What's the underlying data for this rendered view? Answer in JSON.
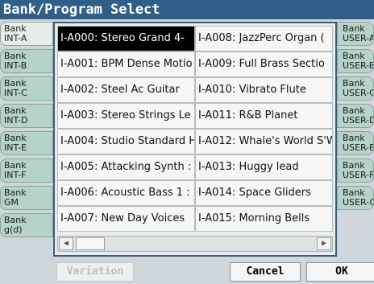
{
  "title": "Bank/Program Select",
  "left_banks": [
    {
      "label": "Bank\nINT-A",
      "selected": true
    },
    {
      "label": "Bank\nINT-B",
      "selected": false
    },
    {
      "label": "Bank\nINT-C",
      "selected": false
    },
    {
      "label": "Bank\nINT-D",
      "selected": false
    },
    {
      "label": "Bank\nINT-E",
      "selected": false
    },
    {
      "label": "Bank\nINT-F",
      "selected": false
    },
    {
      "label": "Bank\nGM",
      "selected": false
    },
    {
      "label": "Bank\ng(d)",
      "selected": false
    }
  ],
  "right_banks": [
    {
      "label": "Bank\nUSER-A"
    },
    {
      "label": "Bank\nUSER-B"
    },
    {
      "label": "Bank\nUSER-C"
    },
    {
      "label": "Bank\nUSER-D"
    },
    {
      "label": "Bank\nUSER-E"
    },
    {
      "label": "Bank\nUSER-F"
    },
    {
      "label": "Bank\nUSER-G"
    }
  ],
  "programs": [
    {
      "label": "I-A000: Stereo Grand 4-",
      "selected": true
    },
    {
      "label": "I-A001: BPM Dense Motio"
    },
    {
      "label": "I-A002: Steel Ac Guitar"
    },
    {
      "label": "I-A003: Stereo Strings Le"
    },
    {
      "label": "I-A004: Studio Standard H"
    },
    {
      "label": "I-A005: Attacking Synth :"
    },
    {
      "label": "I-A006: Acoustic Bass 1 :"
    },
    {
      "label": "I-A007: New Day Voices"
    },
    {
      "label": "I-A008: JazzPerc Organ ("
    },
    {
      "label": "I-A009: Full Brass Sectio"
    },
    {
      "label": "I-A010: Vibrato Flute"
    },
    {
      "label": "I-A011: R&B Planet"
    },
    {
      "label": "I-A012: Whale's World S'W"
    },
    {
      "label": "I-A013: Huggy lead"
    },
    {
      "label": "I-A014: Space Gliders"
    },
    {
      "label": "I-A015: Morning Bells"
    }
  ],
  "scroll": {
    "left_icon": "arrow-left-icon",
    "right_icon": "arrow-right-icon"
  },
  "buttons": {
    "variation": "Variation",
    "cancel": "Cancel",
    "ok": "OK"
  }
}
